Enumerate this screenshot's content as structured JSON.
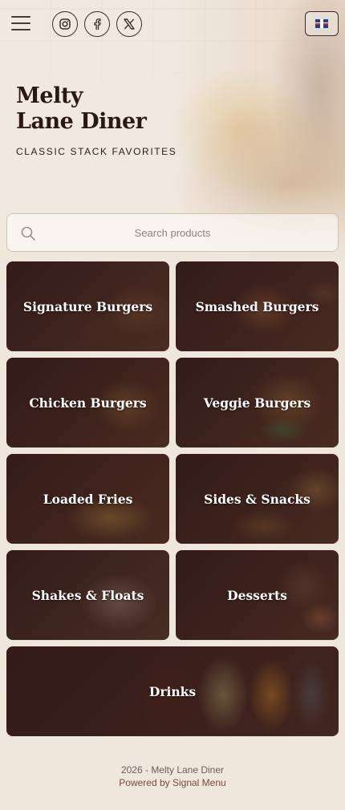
{
  "header": {
    "social": [
      {
        "name": "instagram"
      },
      {
        "name": "facebook"
      },
      {
        "name": "x-twitter"
      }
    ],
    "language": "en-gb-flag"
  },
  "hero": {
    "title_line1": "Melty",
    "title_line2": "Lane Diner",
    "subtitle": "CLASSIC STACK FAVORITES"
  },
  "search": {
    "placeholder": "Search products"
  },
  "categories": [
    {
      "label": "Signature Burgers"
    },
    {
      "label": "Smashed Burgers"
    },
    {
      "label": "Chicken Burgers"
    },
    {
      "label": "Veggie Burgers"
    },
    {
      "label": "Loaded Fries"
    },
    {
      "label": "Sides & Snacks"
    },
    {
      "label": "Shakes & Floats"
    },
    {
      "label": "Desserts"
    },
    {
      "label": "Drinks"
    }
  ],
  "footer": {
    "copyright": "2026 - Melty Lane Diner",
    "powered_by": "Powered by Signal Menu"
  },
  "colors": {
    "background": "#efe6dc",
    "text": "#2a1816",
    "link": "#7a4b3c"
  }
}
